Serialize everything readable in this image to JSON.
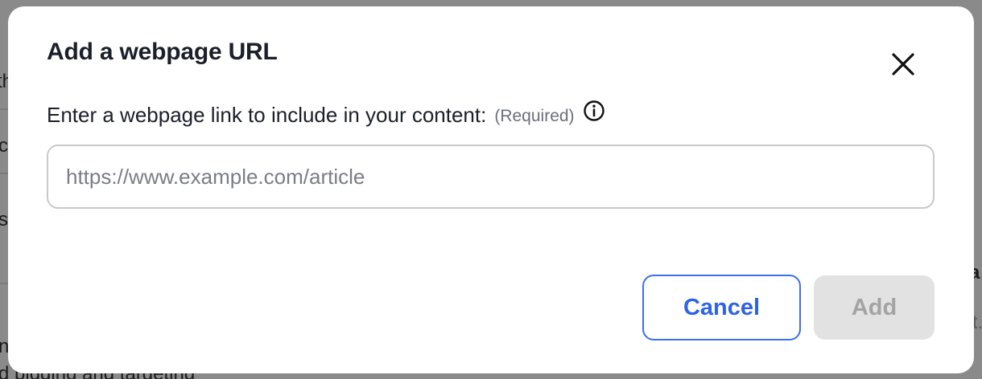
{
  "dialog": {
    "title": "Add a webpage URL",
    "close_icon": "close-icon",
    "field": {
      "label": "Enter a webpage link to include in your content:",
      "required_text": "(Required)",
      "info_icon": "info-icon",
      "value": "",
      "placeholder": "https://www.example.com/article"
    },
    "buttons": {
      "cancel_label": "Cancel",
      "add_label": "Add",
      "add_enabled": false
    }
  },
  "background": {
    "fragments": [
      "th",
      "c",
      "s",
      "a",
      "t.",
      "n",
      "d bidding and targeting"
    ]
  },
  "colors": {
    "overlay": "#8a8a8a",
    "accent": "#2e63e8",
    "disabled_bg": "#e2e2e2",
    "disabled_text": "#a3a3a3"
  }
}
